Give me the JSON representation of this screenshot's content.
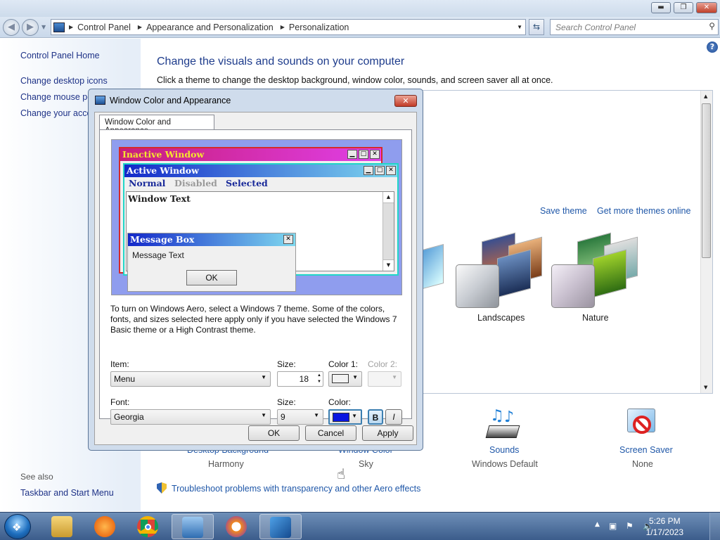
{
  "titlebar": {
    "minimize": "▬",
    "maximize": "❐",
    "close": "✕"
  },
  "address": {
    "segments": [
      "Control Panel",
      "Appearance and Personalization",
      "Personalization"
    ],
    "search_placeholder": "Search Control Panel"
  },
  "left": {
    "home": "Control Panel Home",
    "links": [
      "Change desktop icons",
      "Change mouse po",
      "Change your acco"
    ],
    "see_also": "See also",
    "taskbar_link": "Taskbar and Start Menu"
  },
  "main": {
    "heading": "Change the visuals and sounds on your computer",
    "subheading": "Click a theme to change the desktop background, window color, sounds, and screen saver all at once.",
    "save_theme": "Save theme",
    "get_more": "Get more themes online",
    "themes": [
      {
        "name": "Landscapes"
      },
      {
        "name": "Nature"
      }
    ],
    "bottom": [
      {
        "label": "Desktop Background",
        "value": "Harmony"
      },
      {
        "label": "Window Color",
        "value": "Sky"
      },
      {
        "label": "Sounds",
        "value": "Windows Default"
      },
      {
        "label": "Screen Saver",
        "value": "None"
      }
    ],
    "troubleshoot": "Troubleshoot problems with transparency and other Aero effects"
  },
  "dialog": {
    "title": "Window Color and Appearance",
    "tab": "Window Color and Appearance",
    "preview": {
      "inactive_title": "Inactive Window",
      "active_title": "Active Window",
      "menu_normal": "Normal",
      "menu_disabled": "Disabled",
      "menu_selected": "Selected",
      "window_text": "Window Text",
      "msgbox_title": "Message Box",
      "msgbox_text": "Message Text",
      "ok": "OK"
    },
    "info": "To turn on Windows Aero, select a Windows 7 theme.  Some of the colors, fonts, and sizes selected here apply only if you have selected the Windows 7 Basic theme or a High Contrast theme.",
    "item_label": "Item:",
    "item_value": "Menu",
    "size_label": "Size:",
    "size_value": "18",
    "color1_label": "Color 1:",
    "color2_label": "Color 2:",
    "font_label": "Font:",
    "font_value": "Georgia",
    "font_size_label": "Size:",
    "font_size_value": "9",
    "color_label": "Color:",
    "bold": "B",
    "italic": "I",
    "ok": "OK",
    "cancel": "Cancel",
    "apply": "Apply",
    "colors": {
      "color1": "#f2f2f2",
      "font_color": "#0a16e0",
      "inactive_from": "#c81d7a",
      "inactive_to": "#e040e8",
      "active_from": "#1328c9",
      "active_to": "#7fd9ef",
      "border": "#20d6c8",
      "preview_bg": "#8f9dee"
    }
  },
  "taskbar": {
    "time": "5:26 PM",
    "date": "1/17/2023"
  }
}
